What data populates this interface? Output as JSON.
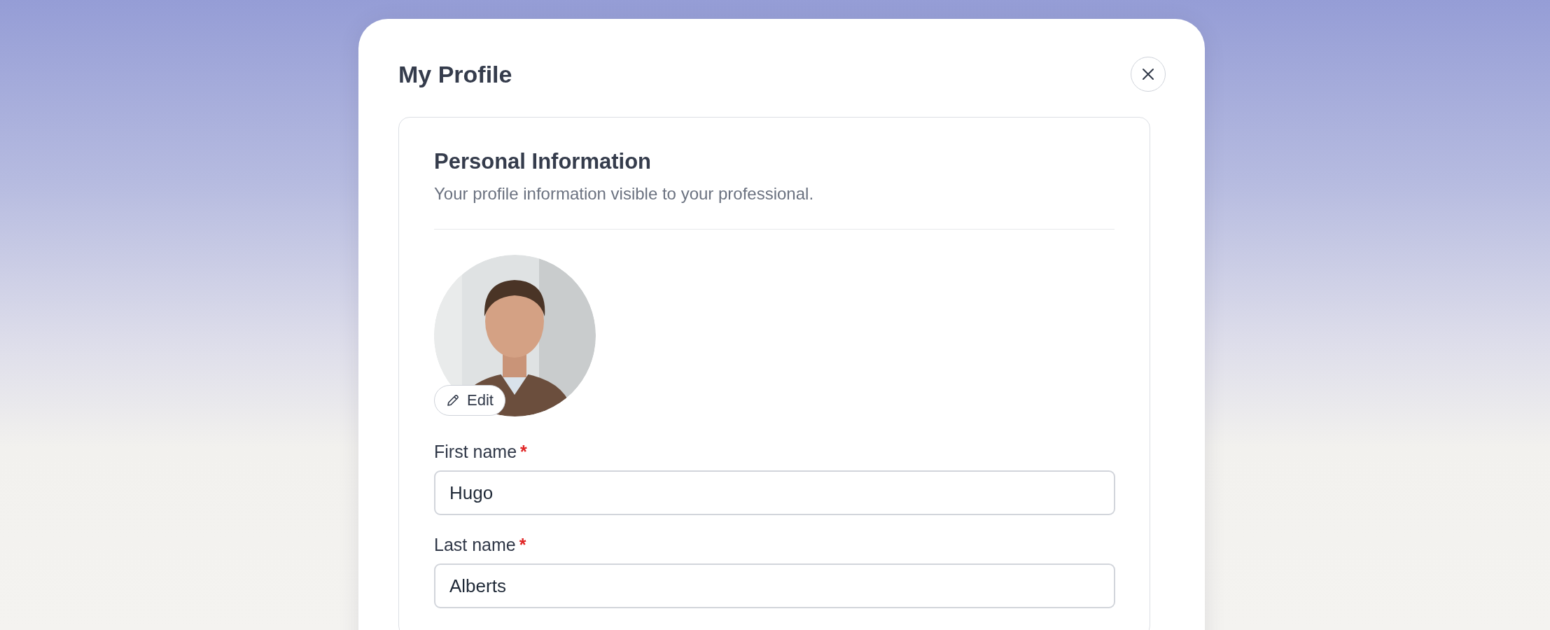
{
  "modal": {
    "title": "My Profile"
  },
  "section": {
    "title": "Personal Information",
    "description": "Your profile information visible to your professional."
  },
  "avatar": {
    "kind": "picture",
    "edit_label": "Edit"
  },
  "fields": [
    {
      "label": "First name",
      "required_mark": "*",
      "value": "Hugo"
    },
    {
      "label": "Last name",
      "required_mark": "*",
      "value": "Alberts"
    }
  ]
}
